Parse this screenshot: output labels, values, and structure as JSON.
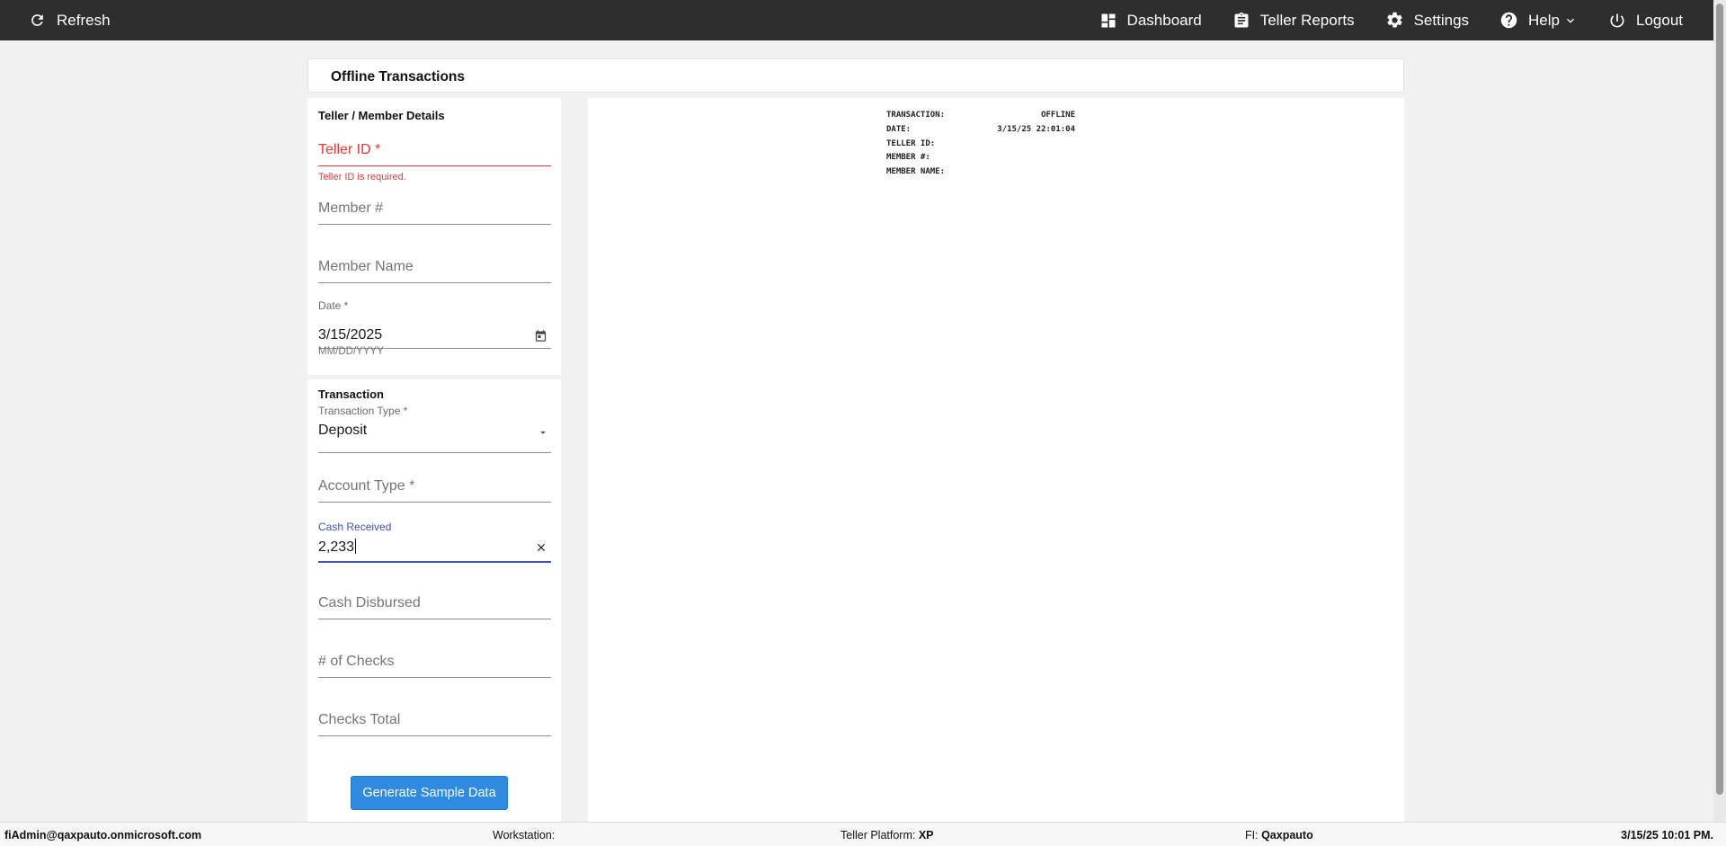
{
  "nav": {
    "refresh_label": "Refresh",
    "items": [
      {
        "label": "Dashboard",
        "icon": "dashboard-icon"
      },
      {
        "label": "Teller Reports",
        "icon": "clipboard-icon"
      },
      {
        "label": "Settings",
        "icon": "gear-icon"
      },
      {
        "label": "Help",
        "icon": "help-circle-icon"
      },
      {
        "label": "Logout",
        "icon": "power-icon"
      }
    ]
  },
  "page": {
    "title": "Offline Transactions"
  },
  "teller_section": {
    "title": "Teller / Member Details",
    "teller_id": {
      "placeholder": "Teller ID *",
      "error": "Teller ID is required."
    },
    "member_number": {
      "placeholder": "Member #"
    },
    "member_name": {
      "placeholder": "Member Name"
    },
    "date": {
      "label": "Date *",
      "value": "3/15/2025",
      "hint": "MM/DD/YYYY"
    }
  },
  "transaction_section": {
    "title": "Transaction",
    "transaction_type": {
      "label": "Transaction Type *",
      "value": "Deposit"
    },
    "account_type": {
      "placeholder": "Account Type *"
    },
    "cash_received": {
      "label": "Cash Received",
      "value": "2,233"
    },
    "cash_disbursed": {
      "placeholder": "Cash Disbursed"
    },
    "num_checks": {
      "placeholder": "# of Checks"
    },
    "checks_total": {
      "placeholder": "Checks Total"
    },
    "generate_button": "Generate Sample Data"
  },
  "receipt": {
    "rows": [
      {
        "label": "TRANSACTION:",
        "value": "OFFLINE"
      },
      {
        "label": "DATE:",
        "value": "3/15/25 22:01:04"
      },
      {
        "label": "TELLER ID:",
        "value": ""
      },
      {
        "label": "MEMBER #:",
        "value": ""
      },
      {
        "label": "MEMBER NAME:",
        "value": ""
      }
    ]
  },
  "footer": {
    "user": "fiAdmin@qaxpauto.onmicrosoft.com",
    "workstation_label": "Workstation:",
    "platform_label": "Teller Platform:",
    "platform_value": "XP",
    "fi_label": "FI:",
    "fi_value": "Qaxpauto",
    "datetime": "3/15/25 10:01 PM."
  },
  "colors": {
    "topbar": "#2e2e2e",
    "error": "#e53935",
    "focus": "#3f51b5",
    "primary_button": "#2f8ae0"
  }
}
